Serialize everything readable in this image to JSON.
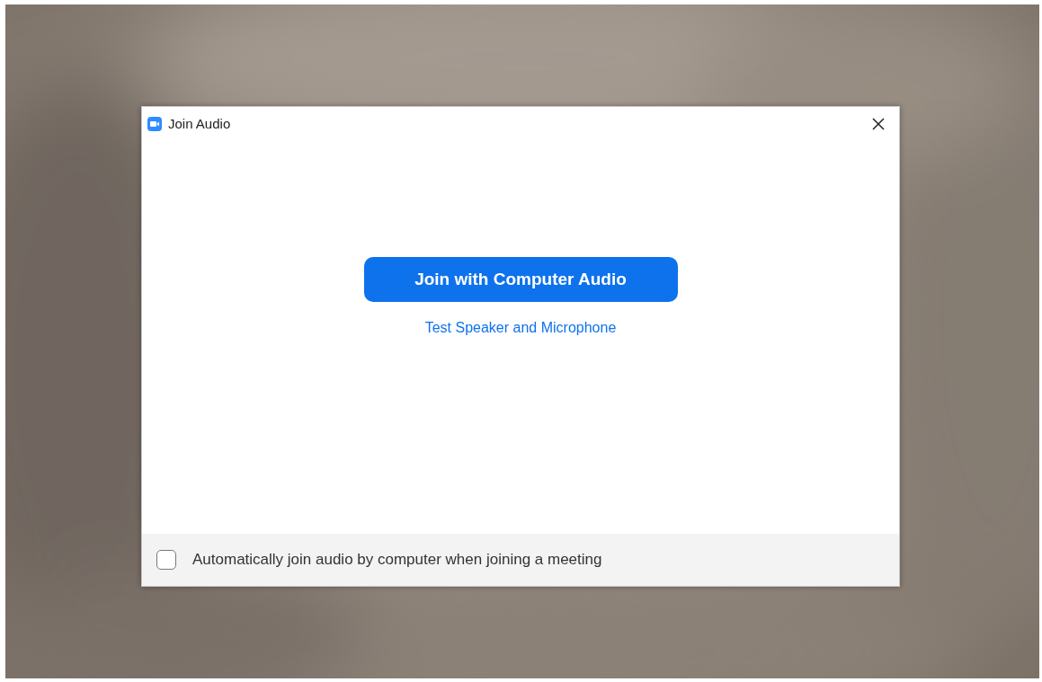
{
  "window": {
    "title": "Join Audio"
  },
  "primary_button": {
    "label": "Join with Computer Audio"
  },
  "link": {
    "label": "Test Speaker and Microphone"
  },
  "auto_join": {
    "label": "Automatically join audio by computer when joining a meeting",
    "checked": false
  }
}
